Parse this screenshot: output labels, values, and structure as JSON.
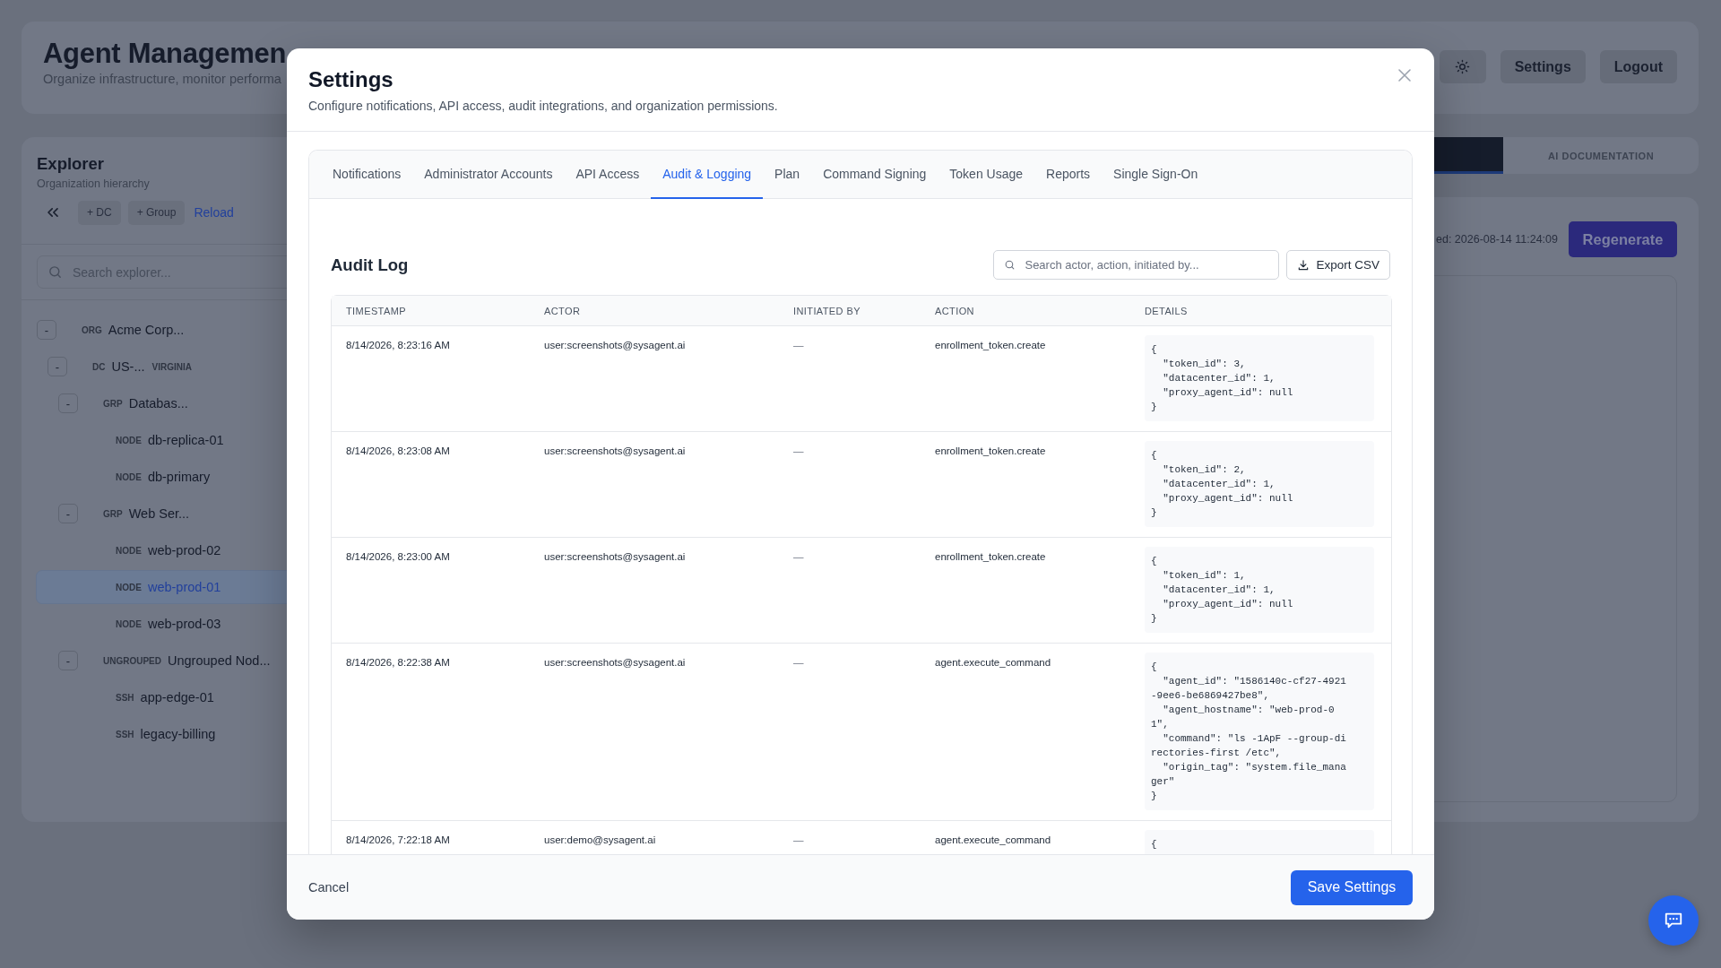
{
  "app": {
    "title": "Agent Managemen",
    "subtitle": "Organize infrastructure, monitor performa",
    "buttons": [
      "Settings",
      "Logout"
    ]
  },
  "explorer": {
    "title": "Explorer",
    "subtitle": "Organization hierarchy",
    "actions": [
      "+ DC",
      "+ Group"
    ],
    "reload": "Reload",
    "search_placeholder": "Search explorer...",
    "tree": [
      {
        "label": "ORG",
        "name": "Acme Corp...",
        "toggle": "-",
        "selected": false,
        "children": [
          {
            "label": "DC",
            "name": "US-...",
            "tag": "VIRGINIA",
            "toggle": "-",
            "selected": false,
            "children": [
              {
                "label": "GRP",
                "name": "Databas...",
                "toggle": "-",
                "selected": false,
                "children": [
                  {
                    "label": "NODE",
                    "name": "db-replica-01",
                    "selected": false
                  },
                  {
                    "label": "NODE",
                    "name": "db-primary",
                    "selected": false
                  }
                ]
              },
              {
                "label": "GRP",
                "name": "Web Ser...",
                "toggle": "-",
                "selected": false,
                "children": [
                  {
                    "label": "NODE",
                    "name": "web-prod-02",
                    "selected": false
                  },
                  {
                    "label": "NODE",
                    "name": "web-prod-01",
                    "selected": true
                  },
                  {
                    "label": "NODE",
                    "name": "web-prod-03",
                    "selected": false
                  }
                ]
              },
              {
                "label": "UNGROUPED",
                "name": "Ungrouped Nod...",
                "toggle": "-",
                "selected": false,
                "children": [
                  {
                    "label": "SSH",
                    "name": "app-edge-01",
                    "selected": false
                  },
                  {
                    "label": "SSH",
                    "name": "legacy-billing",
                    "selected": false
                  }
                ]
              }
            ]
          }
        ]
      }
    ]
  },
  "view_tabs": [
    {
      "selected": true
    },
    {
      "label": "AI DOCUMENTATION",
      "selected": false
    }
  ],
  "documentation": {
    "generated": "ed: 2026-08-14 11:24:09",
    "regenerate": "Regenerate"
  },
  "modal": {
    "title": "Settings",
    "subtitle": "Configure notifications, API access, audit integrations, and organization permissions.",
    "tabs": [
      {
        "label": "Notifications",
        "selected": false
      },
      {
        "label": "Administrator Accounts",
        "selected": false
      },
      {
        "label": "API Access",
        "selected": false
      },
      {
        "label": "Audit & Logging",
        "selected": true
      },
      {
        "label": "Plan",
        "selected": false
      },
      {
        "label": "Command Signing",
        "selected": false
      },
      {
        "label": "Token Usage",
        "selected": false
      },
      {
        "label": "Reports",
        "selected": false
      },
      {
        "label": "Single Sign-On",
        "selected": false
      }
    ],
    "audit": {
      "title": "Audit Log",
      "search_placeholder": "Search actor, action, initiated by...",
      "export": "Export CSV",
      "columns": [
        "TIMESTAMP",
        "ACTOR",
        "INITIATED BY",
        "ACTION",
        "DETAILS"
      ],
      "rows": [
        {
          "timestamp": "8/14/2026, 8:23:16 AM",
          "actor": "user:screenshots@sysagent.ai",
          "initiated_by": "—",
          "action": "enrollment_token.create",
          "details": "{\n  \"token_id\": 3,\n  \"datacenter_id\": 1,\n  \"proxy_agent_id\": null\n}"
        },
        {
          "timestamp": "8/14/2026, 8:23:08 AM",
          "actor": "user:screenshots@sysagent.ai",
          "initiated_by": "—",
          "action": "enrollment_token.create",
          "details": "{\n  \"token_id\": 2,\n  \"datacenter_id\": 1,\n  \"proxy_agent_id\": null\n}"
        },
        {
          "timestamp": "8/14/2026, 8:23:00 AM",
          "actor": "user:screenshots@sysagent.ai",
          "initiated_by": "—",
          "action": "enrollment_token.create",
          "details": "{\n  \"token_id\": 1,\n  \"datacenter_id\": 1,\n  \"proxy_agent_id\": null\n}"
        },
        {
          "timestamp": "8/14/2026, 8:22:38 AM",
          "actor": "user:screenshots@sysagent.ai",
          "initiated_by": "—",
          "action": "agent.execute_command",
          "details": "{\n  \"agent_id\": \"1586140c-cf27-4921\n-9ee6-be6869427be8\",\n  \"agent_hostname\": \"web-prod-0\n1\",\n  \"command\": \"ls -1ApF --group-di\nrectories-first /etc\",\n  \"origin_tag\": \"system.file_mana\nger\"\n}"
        },
        {
          "timestamp": "8/14/2026, 7:22:18 AM",
          "actor": "user:demo@sysagent.ai",
          "initiated_by": "—",
          "action": "agent.execute_command",
          "details": "{"
        }
      ]
    },
    "cancel": "Cancel",
    "save": "Save Settings"
  }
}
